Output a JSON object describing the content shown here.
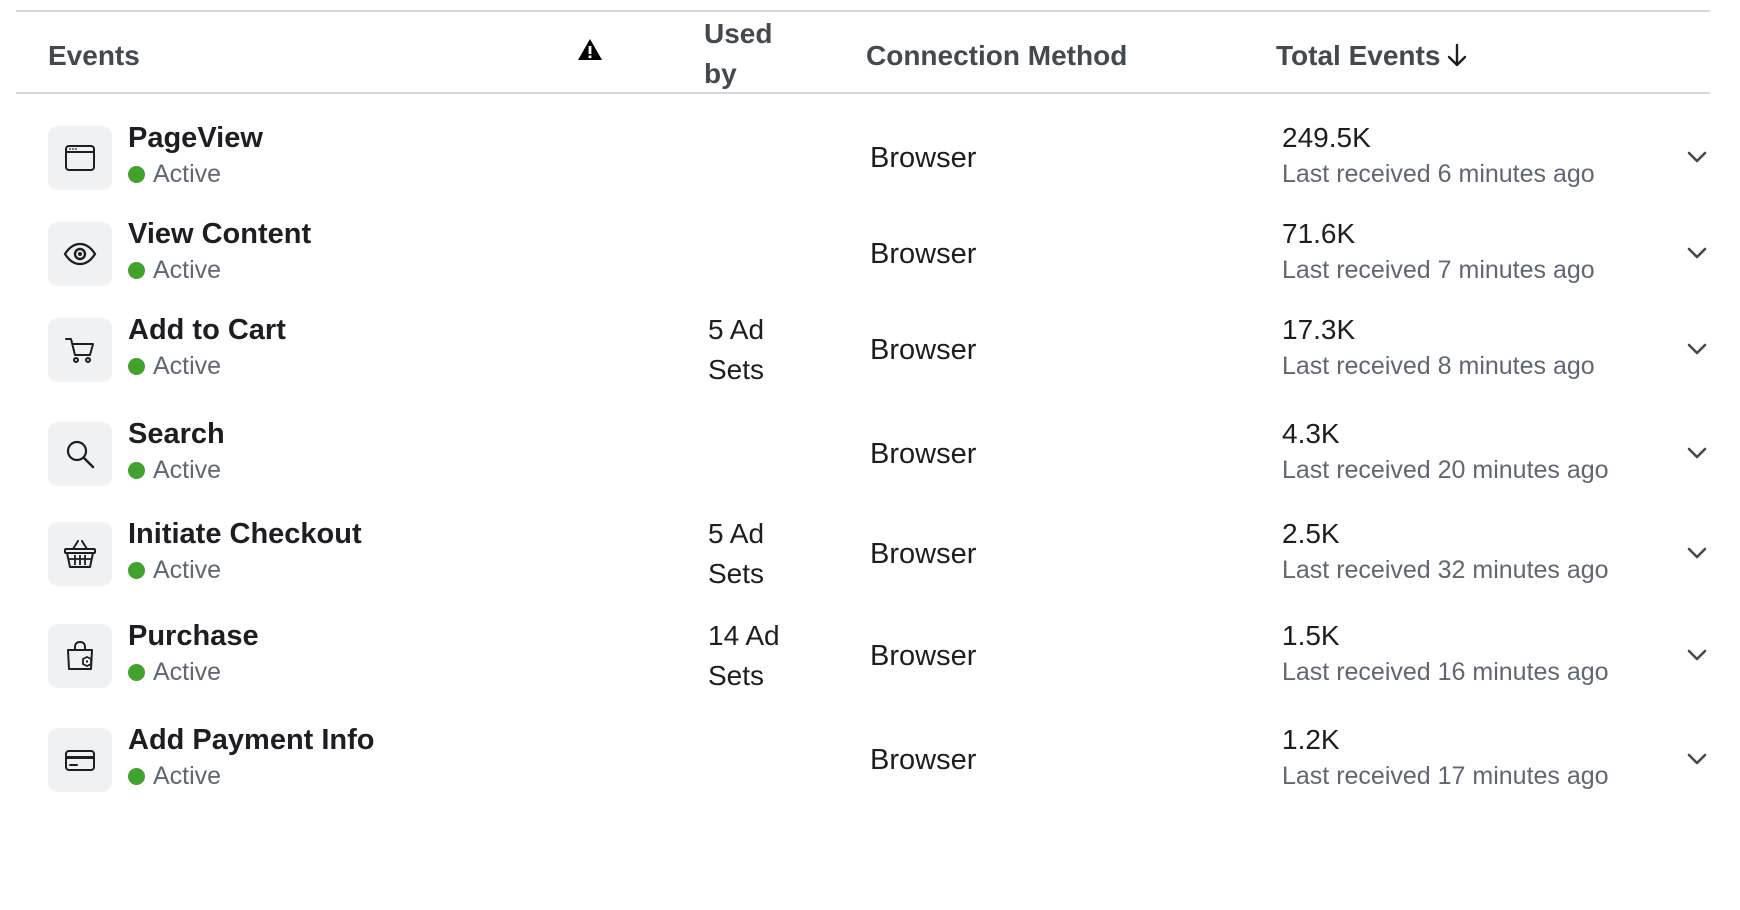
{
  "header": {
    "events": "Events",
    "warning_icon": "warning-triangle-icon",
    "used_by": "Used by",
    "connection_method": "Connection Method",
    "total_events": "Total Events",
    "sort_icon": "arrow-down-icon"
  },
  "colors": {
    "active_dot": "#42a12f",
    "icon_bg": "#f0f1f2",
    "muted_text": "#606770"
  },
  "events": [
    {
      "name": "PageView",
      "icon": "browser-window-icon",
      "status": "Active",
      "used_by": "",
      "connection": "Browser",
      "total": "249.5K",
      "last_received": "Last received 6 minutes ago"
    },
    {
      "name": "View Content",
      "icon": "eye-icon",
      "status": "Active",
      "used_by": "",
      "connection": "Browser",
      "total": "71.6K",
      "last_received": "Last received 7 minutes ago"
    },
    {
      "name": "Add to Cart",
      "icon": "cart-icon",
      "status": "Active",
      "used_by": "5 Ad Sets",
      "connection": "Browser",
      "total": "17.3K",
      "last_received": "Last received 8 minutes ago"
    },
    {
      "name": "Search",
      "icon": "search-icon",
      "status": "Active",
      "used_by": "",
      "connection": "Browser",
      "total": "4.3K",
      "last_received": "Last received 20 minutes ago"
    },
    {
      "name": "Initiate Checkout",
      "icon": "basket-icon",
      "status": "Active",
      "used_by": "5 Ad Sets",
      "connection": "Browser",
      "total": "2.5K",
      "last_received": "Last received 32 minutes ago"
    },
    {
      "name": "Purchase",
      "icon": "shopping-bag-icon",
      "status": "Active",
      "used_by": "14 Ad Sets",
      "connection": "Browser",
      "total": "1.5K",
      "last_received": "Last received 16 minutes ago"
    },
    {
      "name": "Add Payment Info",
      "icon": "credit-card-icon",
      "status": "Active",
      "used_by": "",
      "connection": "Browser",
      "total": "1.2K",
      "last_received": "Last received 17 minutes ago"
    }
  ]
}
